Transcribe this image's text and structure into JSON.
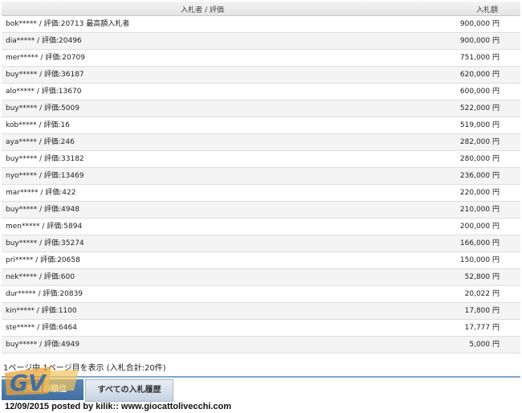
{
  "table": {
    "header_bidder": "入札者 / 評価",
    "header_amount": "入札額",
    "rows": [
      {
        "bidder": "bok***** / 評価:20713 最高額入札者",
        "amount": "900,000 円"
      },
      {
        "bidder": "dia***** / 評価:20496",
        "amount": "900,000 円"
      },
      {
        "bidder": "mer***** / 評価:20709",
        "amount": "751,000 円"
      },
      {
        "bidder": "buy***** / 評価:36187",
        "amount": "620,000 円"
      },
      {
        "bidder": "alo***** / 評価:13670",
        "amount": "600,000 円"
      },
      {
        "bidder": "buy***** / 評価:5009",
        "amount": "522,000 円"
      },
      {
        "bidder": "kob***** / 評価:16",
        "amount": "519,000 円"
      },
      {
        "bidder": "aya***** / 評価:246",
        "amount": "282,000 円"
      },
      {
        "bidder": "buy***** / 評価:33182",
        "amount": "280,000 円"
      },
      {
        "bidder": "nyo***** / 評価:13469",
        "amount": "236,000 円"
      },
      {
        "bidder": "mar***** / 評価:422",
        "amount": "220,000 円"
      },
      {
        "bidder": "buy***** / 評価:4948",
        "amount": "210,000 円"
      },
      {
        "bidder": "men***** / 評価:5894",
        "amount": "200,000 円"
      },
      {
        "bidder": "buy***** / 評価:35274",
        "amount": "166,000 円"
      },
      {
        "bidder": "pri***** / 評価:20658",
        "amount": "150,000 円"
      },
      {
        "bidder": "nek***** / 評価:600",
        "amount": "52,800 円"
      },
      {
        "bidder": "dur***** / 評価:20839",
        "amount": "20,022 円"
      },
      {
        "bidder": "kin***** / 評価:1100",
        "amount": "17,800 円"
      },
      {
        "bidder": "ste***** / 評価:6464",
        "amount": "17,777 円"
      },
      {
        "bidder": "buy***** / 評価:4949",
        "amount": "5,000 円"
      }
    ]
  },
  "pagination_text": "1ページ中 1ページ目を表示 (入札合計:20件)",
  "tabs": {
    "ranking_label": "入札者の順位",
    "history_label": "すべての入札履歴"
  },
  "logo_text": "GV",
  "watermark": "12/09/2015 posted by kilik:: www.giocattolivecchi.com",
  "colors": {
    "tab_active": "#4a78a8",
    "tab_border": "#7fa6cc"
  }
}
